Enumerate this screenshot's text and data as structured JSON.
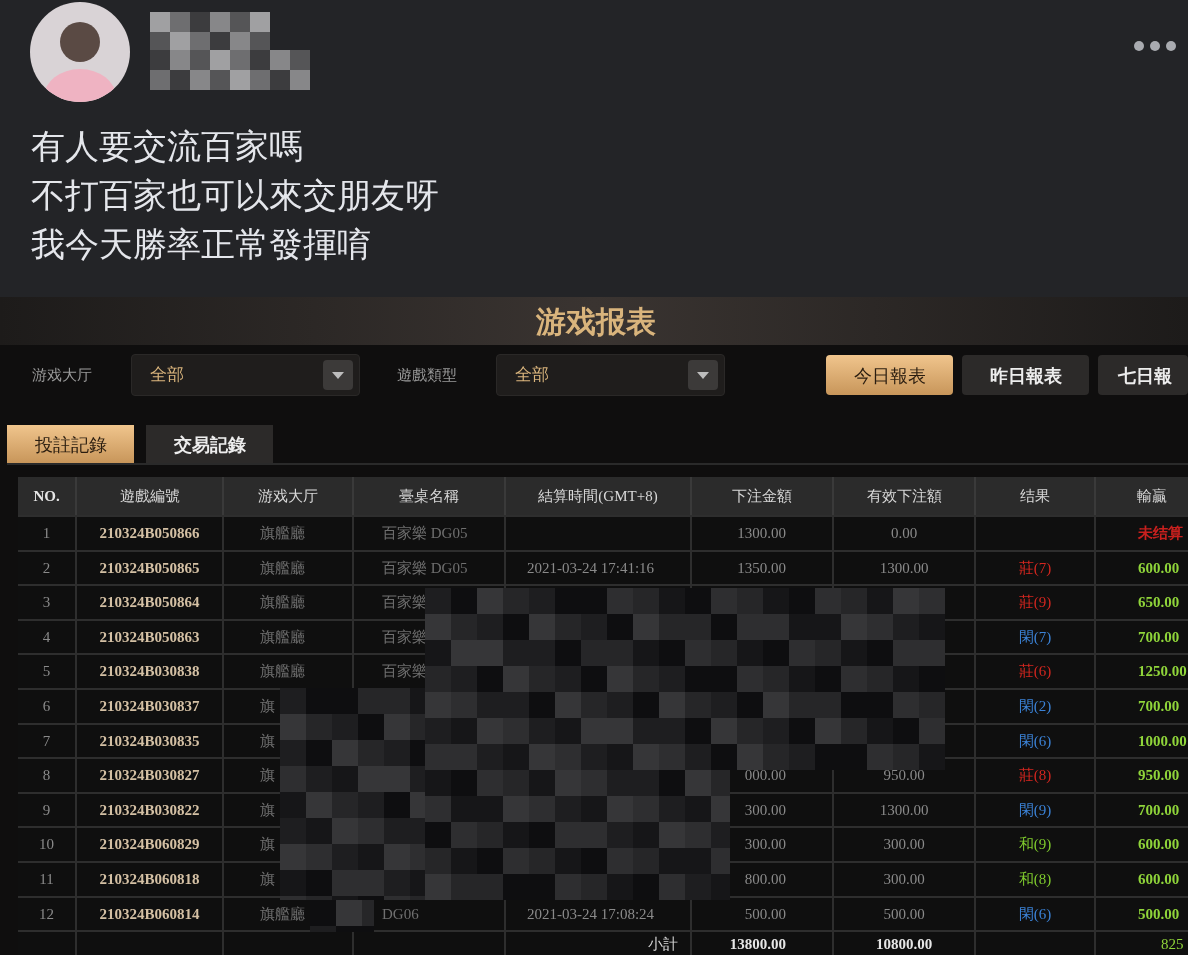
{
  "post": {
    "text_lines": [
      "有人要交流百家嗎",
      "不打百家也可以來交朋友呀",
      "我今天勝率正常發揮唷"
    ]
  },
  "report": {
    "title": "游戏报表",
    "filters": [
      {
        "label": "游戏大厅",
        "value": "全部"
      },
      {
        "label": "遊戲類型",
        "value": "全部"
      }
    ],
    "range_buttons": [
      {
        "label": "今日報表",
        "selected": true
      },
      {
        "label": "昨日報表",
        "selected": false
      },
      {
        "label": "七日報",
        "selected": false
      }
    ],
    "tabs": [
      {
        "label": "投註記錄",
        "selected": true
      },
      {
        "label": "交易記錄",
        "selected": false
      }
    ],
    "table": {
      "columns": [
        "NO.",
        "遊戲編號",
        "游戏大厅",
        "臺桌名稱",
        "結算時間(GMT+8)",
        "下注金額",
        "有效下注額",
        "结果",
        "輸贏"
      ],
      "rows": [
        {
          "no": "1",
          "game_id": "210324B050866",
          "hall": "旗艦廳",
          "table_name": "百家樂 DG05",
          "bet": "1300.00",
          "valid_bet": "0.00",
          "win": {
            "text": "未结算",
            "color": "#c8201e"
          }
        },
        {
          "no": "2",
          "game_id": "210324B050865",
          "hall": "旗艦廳",
          "table_name": "百家樂 DG05",
          "settle_time": "2021-03-24 17:41:16",
          "bet": "1350.00",
          "valid_bet": "1300.00",
          "result": {
            "text": "莊(7)",
            "color": "#d3261f"
          },
          "win": {
            "text": "600.00",
            "color": "#8fd43a"
          }
        },
        {
          "no": "3",
          "game_id": "210324B050864",
          "hall": "旗艦廳",
          "table_name": "百家樂",
          "result": {
            "text": "莊(9)",
            "color": "#d3261f"
          },
          "win": {
            "text": "650.00",
            "color": "#8fd43a"
          }
        },
        {
          "no": "4",
          "game_id": "210324B050863",
          "hall": "旗艦廳",
          "table_name": "百家樂",
          "result": {
            "text": "閑(7)",
            "color": "#3b82d6"
          },
          "win": {
            "text": "700.00",
            "color": "#8fd43a"
          }
        },
        {
          "no": "5",
          "game_id": "210324B030838",
          "hall": "旗艦廳",
          "table_name": "百家樂",
          "result": {
            "text": "莊(6)",
            "color": "#d3261f"
          },
          "win": {
            "text": "1250.00",
            "color": "#8fd43a"
          }
        },
        {
          "no": "6",
          "game_id": "210324B030837",
          "hall": "旗",
          "result": {
            "text": "閑(2)",
            "color": "#3b82d6"
          },
          "win": {
            "text": "700.00",
            "color": "#8fd43a"
          }
        },
        {
          "no": "7",
          "game_id": "210324B030835",
          "hall": "旗",
          "result": {
            "text": "閑(6)",
            "color": "#3b82d6"
          },
          "win": {
            "text": "1000.00",
            "color": "#8fd43a"
          }
        },
        {
          "no": "8",
          "game_id": "210324B030827",
          "hall": "旗",
          "bet": "000.00",
          "valid_bet": "950.00",
          "result": {
            "text": "莊(8)",
            "color": "#d3261f"
          },
          "win": {
            "text": "950.00",
            "color": "#8fd43a"
          }
        },
        {
          "no": "9",
          "game_id": "210324B030822",
          "hall": "旗",
          "bet": "300.00",
          "valid_bet": "1300.00",
          "result": {
            "text": "閑(9)",
            "color": "#3b82d6"
          },
          "win": {
            "text": "700.00",
            "color": "#8fd43a"
          }
        },
        {
          "no": "10",
          "game_id": "210324B060829",
          "hall": "旗",
          "bet": "300.00",
          "valid_bet": "300.00",
          "result": {
            "text": "和(9)",
            "color": "#7fcb2d"
          },
          "win": {
            "text": "600.00",
            "color": "#8fd43a"
          }
        },
        {
          "no": "11",
          "game_id": "210324B060818",
          "hall": "旗",
          "bet": "800.00",
          "valid_bet": "300.00",
          "result": {
            "text": "和(8)",
            "color": "#7fcb2d"
          },
          "win": {
            "text": "600.00",
            "color": "#8fd43a"
          }
        },
        {
          "no": "12",
          "game_id": "210324B060814",
          "hall": "旗艦廳",
          "table_name": "DG06",
          "settle_time": "2021-03-24 17:08:24",
          "bet": "500.00",
          "valid_bet": "500.00",
          "result": {
            "text": "閑(6)",
            "color": "#3b82d6"
          },
          "win": {
            "text": "500.00",
            "color": "#8fd43a"
          }
        }
      ],
      "subtotal": {
        "label": "小計",
        "bet": "13800.00",
        "valid_bet": "10800.00",
        "win": "825"
      }
    }
  }
}
